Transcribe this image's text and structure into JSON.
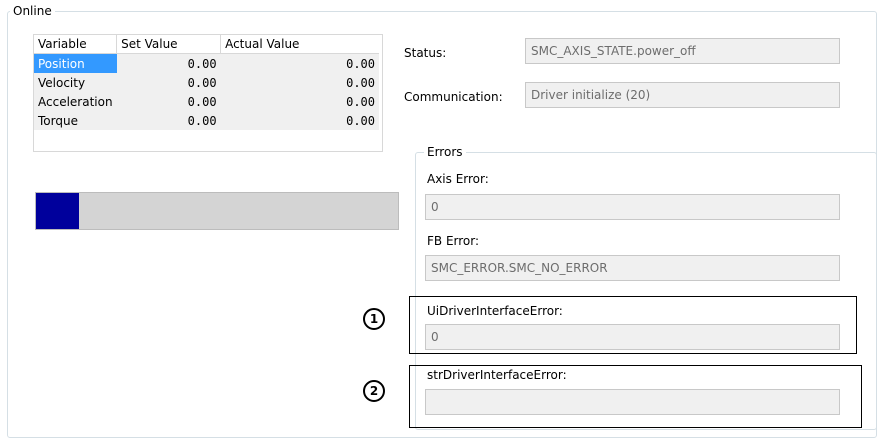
{
  "online_group": {
    "title": "Online"
  },
  "variables_table": {
    "headers": [
      "Variable",
      "Set Value",
      "Actual Value"
    ],
    "rows": [
      {
        "variable": "Position",
        "set_value": "0.00",
        "actual_value": "0.00"
      },
      {
        "variable": "Velocity",
        "set_value": "0.00",
        "actual_value": "0.00"
      },
      {
        "variable": "Acceleration",
        "set_value": "0.00",
        "actual_value": "0.00"
      },
      {
        "variable": "Torque",
        "set_value": "0.00",
        "actual_value": "0.00"
      }
    ],
    "selected_row": "Position"
  },
  "progress": {
    "fraction": 0.12,
    "color": "#00009c"
  },
  "status": {
    "label": "Status:",
    "value": "SMC_AXIS_STATE.power_off"
  },
  "communication": {
    "label": "Communication:",
    "value": "Driver initialize (20)"
  },
  "errors_group": {
    "title": "Errors",
    "axis_error": {
      "label": "Axis Error:",
      "value": "0"
    },
    "fb_error": {
      "label": "FB Error:",
      "value": "SMC_ERROR.SMC_NO_ERROR"
    },
    "ui_driver_interface_error": {
      "label": "UiDriverInterfaceError:",
      "value": "0"
    },
    "str_driver_interface_error": {
      "label": "strDriverInterfaceError:",
      "value": ""
    }
  },
  "callouts": {
    "marker_1": "1",
    "marker_2": "2"
  }
}
